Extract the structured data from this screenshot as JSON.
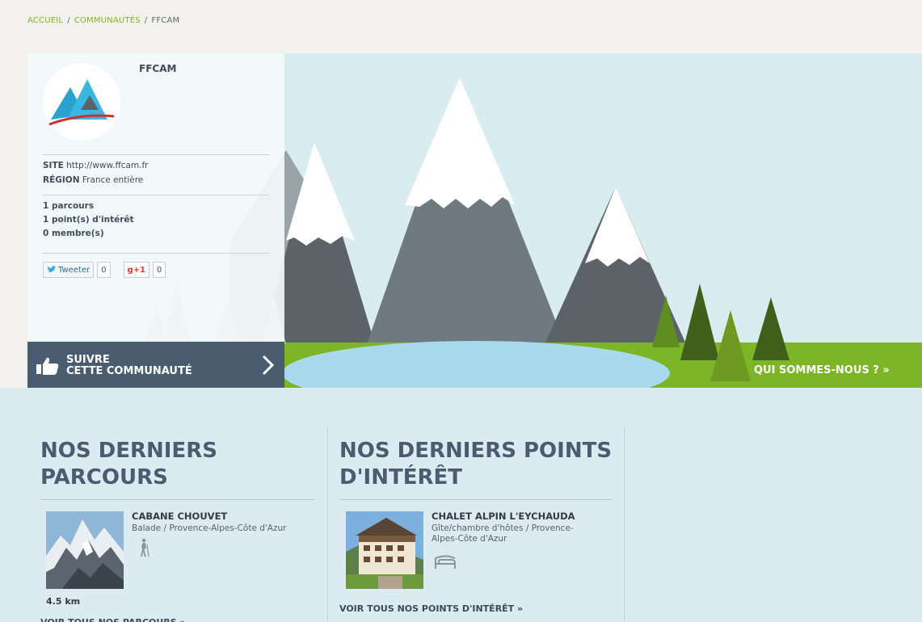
{
  "breadcrumb": {
    "home": "ACCUEIL",
    "communities": "COMMUNAUTÉS",
    "current": "FFCAM",
    "sep": "/"
  },
  "profile": {
    "name": "FFCAM",
    "site_label": "SITE",
    "site_value": "http://www.ffcam.fr",
    "region_label": "RÉGION",
    "region_value": "France entière",
    "stats": [
      "1 parcours",
      "1 point(s) d'intérêt",
      "0 membre(s)"
    ]
  },
  "social": {
    "tweet_label": "Tweeter",
    "tweet_count": "0",
    "gplus_label": "g+1",
    "gplus_count": "0"
  },
  "follow": {
    "line1": "SUIVRE",
    "line2": "CETTE COMMUNAUTÉ"
  },
  "about": {
    "label": "QUI SOMMES-NOUS ? »"
  },
  "routes": {
    "title_line1": "NOS DERNIERS",
    "title_line2": "PARCOURS",
    "item": {
      "title": "CABANE CHOUVET",
      "meta": "Balade / Provence-Alpes-Côte d'Azur",
      "distance": "4.5 km",
      "icon": "hiker-icon"
    },
    "see_all": "VOIR TOUS NOS PARCOURS »"
  },
  "pois": {
    "title_line1": "NOS DERNIERS POINTS",
    "title_line2": "D'INTÉRÊT",
    "item": {
      "title": "CHALET ALPIN L'EYCHAUDA",
      "meta_line1": "Gîte/chambre d'hôtes / Provence-",
      "meta_line2": "Alpes-Côte d'Azur",
      "icon": "bed-icon"
    },
    "see_all": "VOIR TOUS NOS POINTS D'INTÉRÊT »"
  },
  "colors": {
    "accent": "#7cb526",
    "dark_slate": "#4a5d70",
    "sky": "#d9ecef",
    "grass": "#7cb526",
    "lake": "#a9d9ec"
  }
}
